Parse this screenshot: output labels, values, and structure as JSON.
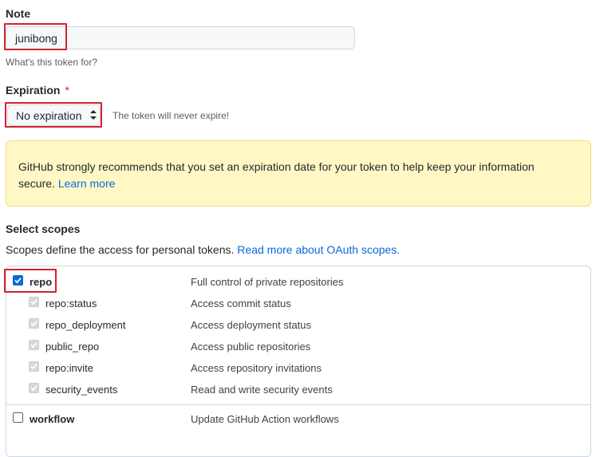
{
  "note": {
    "label": "Note",
    "value": "junibong",
    "hint": "What's this token for?"
  },
  "expiration": {
    "label": "Expiration",
    "required_mark": "*",
    "selected": "No expiration",
    "hint": "The token will never expire!"
  },
  "warning": {
    "text": "GitHub strongly recommends that you set an expiration date for your token to help keep your information secure.",
    "link": "Learn more"
  },
  "scopes": {
    "title": "Select scopes",
    "description": "Scopes define the access for personal tokens.",
    "link": "Read more about OAuth scopes.",
    "items": [
      {
        "name": "repo",
        "description": "Full control of private repositories",
        "checked": true
      },
      {
        "name": "repo:status",
        "description": "Access commit status",
        "checked": true
      },
      {
        "name": "repo_deployment",
        "description": "Access deployment status",
        "checked": true
      },
      {
        "name": "public_repo",
        "description": "Access public repositories",
        "checked": true
      },
      {
        "name": "repo:invite",
        "description": "Access repository invitations",
        "checked": true
      },
      {
        "name": "security_events",
        "description": "Read and write security events",
        "checked": true
      },
      {
        "name": "workflow",
        "description": "Update GitHub Action workflows",
        "checked": false
      }
    ]
  },
  "colors": {
    "highlight": "#d1242f",
    "accent": "#0969da",
    "warning_bg": "#fff8c5"
  }
}
